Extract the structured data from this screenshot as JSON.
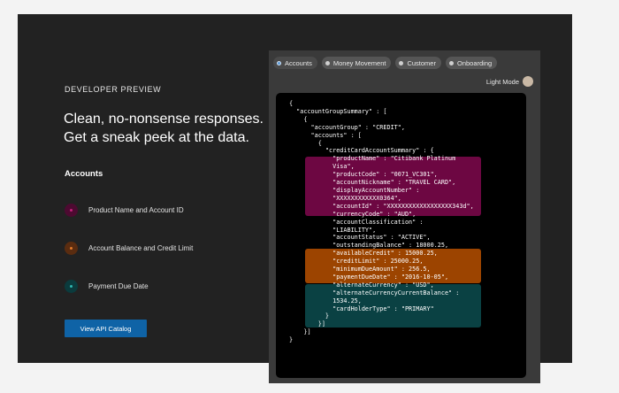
{
  "intro": {
    "eyebrow": "DEVELOPER PREVIEW",
    "headline": "Clean, no-nonsense responses. Get a sneak peek at the data.",
    "accounts_title": "Accounts",
    "legend": [
      {
        "label": "Product Name and Account ID",
        "color": "#6d0742",
        "dot": "#a0105f"
      },
      {
        "label": "Account Balance and Credit Limit",
        "color": "#7a3a12",
        "dot": "#e07a2a"
      },
      {
        "label": "Payment Due Date",
        "color": "#0d4a4c",
        "dot": "#2fb6b0"
      }
    ],
    "cta_label": "View API Catalog"
  },
  "tabs": [
    {
      "label": "Accounts",
      "active": true
    },
    {
      "label": "Money Movement",
      "active": false
    },
    {
      "label": "Customer",
      "active": false
    },
    {
      "label": "Onboarding",
      "active": false
    }
  ],
  "light_mode_label": "Light Mode",
  "code_lines": [
    "{",
    "  \"accountGroupSummary\" : [",
    "    {",
    "      \"accountGroup\" : \"CREDIT\",",
    "      \"accounts\" : [",
    "        {",
    "          \"creditCardAccountSummary\" : {",
    "            \"productName\" : \"Citibank Platinum",
    "            Visa\",",
    "            \"productCode\" : \"0071_VC301\",",
    "            \"accountNickname\" : \"TRAVEL CARD\",",
    "            \"displayAccountNumber\" :",
    "            \"XXXXXXXXXXXX0364\",",
    "            \"accountId\" : \"XXXXXXXXXXXXXXXXXX343d\",",
    "            \"currencyCode\" : \"AUD\",",
    "            \"accountClassification\" :",
    "            \"LIABILITY\",",
    "            \"accountStatus\" : \"ACTIVE\",",
    "            \"outstandingBalance\" : 18000.25,",
    "            \"availableCredit\" : 15000.25,",
    "            \"creditLimit\" : 25000.25,",
    "            \"minimumDueAmount\" : 256.5,",
    "            \"paymentDueDate\" : \"2016-10-05\",",
    "            \"alternateCurrency\" : \"USD\",",
    "            \"alternateCurrencyCurrentBalance\" :",
    "            1534.25,",
    "            \"cardHolderType\" : \"PRIMARY\"",
    "          }",
    "        }]",
    "    }]",
    "}"
  ]
}
